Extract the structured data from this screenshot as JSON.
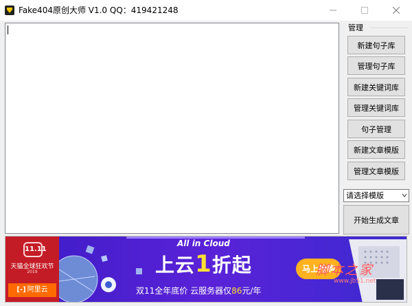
{
  "window": {
    "title": "Fake404原创大师 V1.0   QQ：419421248",
    "minimize_icon": "minimize-icon",
    "maximize_icon": "maximize-icon",
    "close_icon": "close-icon"
  },
  "editor": {
    "value": ""
  },
  "manage_group": {
    "label": "管理",
    "buttons": [
      {
        "label": "新建句子库"
      },
      {
        "label": "管理句子库"
      },
      {
        "label": "新建关键词库"
      },
      {
        "label": "管理关键词库"
      },
      {
        "label": "句子管理"
      },
      {
        "label": "新建文章模版"
      },
      {
        "label": "管理文章模版"
      }
    ]
  },
  "template_select": {
    "value": "请选择模版"
  },
  "generate_button": {
    "label": "开始生成文章"
  },
  "banner": {
    "badge": "11.11",
    "festival": "天猫全球狂欢节",
    "year": "2019",
    "brand_mark": "[-]",
    "brand": "阿里云",
    "tagline": "All in Cloud",
    "headline_pre": "上云",
    "headline_num": "1",
    "headline_post": "折起",
    "sub_pre": "双11全年底价  云服务器仅",
    "sub_price": "86",
    "sub_post": "元/年",
    "cta": "马上抢购"
  },
  "watermark": {
    "text": "脚本之家",
    "url": "www.jb51.net"
  },
  "colors": {
    "banner_bg": "#4b1fcf",
    "banner_left": "#c41c26",
    "highlight": "#ffe033",
    "aliyun": "#ff6a00"
  }
}
